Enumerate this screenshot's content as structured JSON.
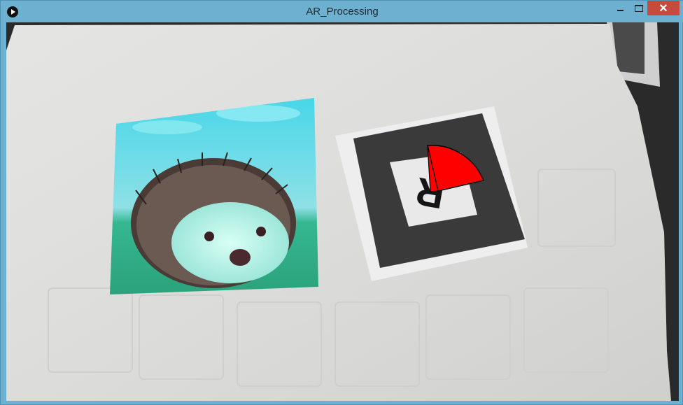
{
  "window": {
    "title": "AR_Processing",
    "close_glyph": "✕"
  },
  "icons": {
    "app": "processing-app-icon",
    "minimize": "minimize-icon",
    "maximize": "maximize-icon",
    "close": "close-icon"
  },
  "colors": {
    "titlebar": "#6eb0cf",
    "close_button": "#c74a3e",
    "ar_overlay": "#ff0000"
  },
  "marker": {
    "letter": "R"
  }
}
